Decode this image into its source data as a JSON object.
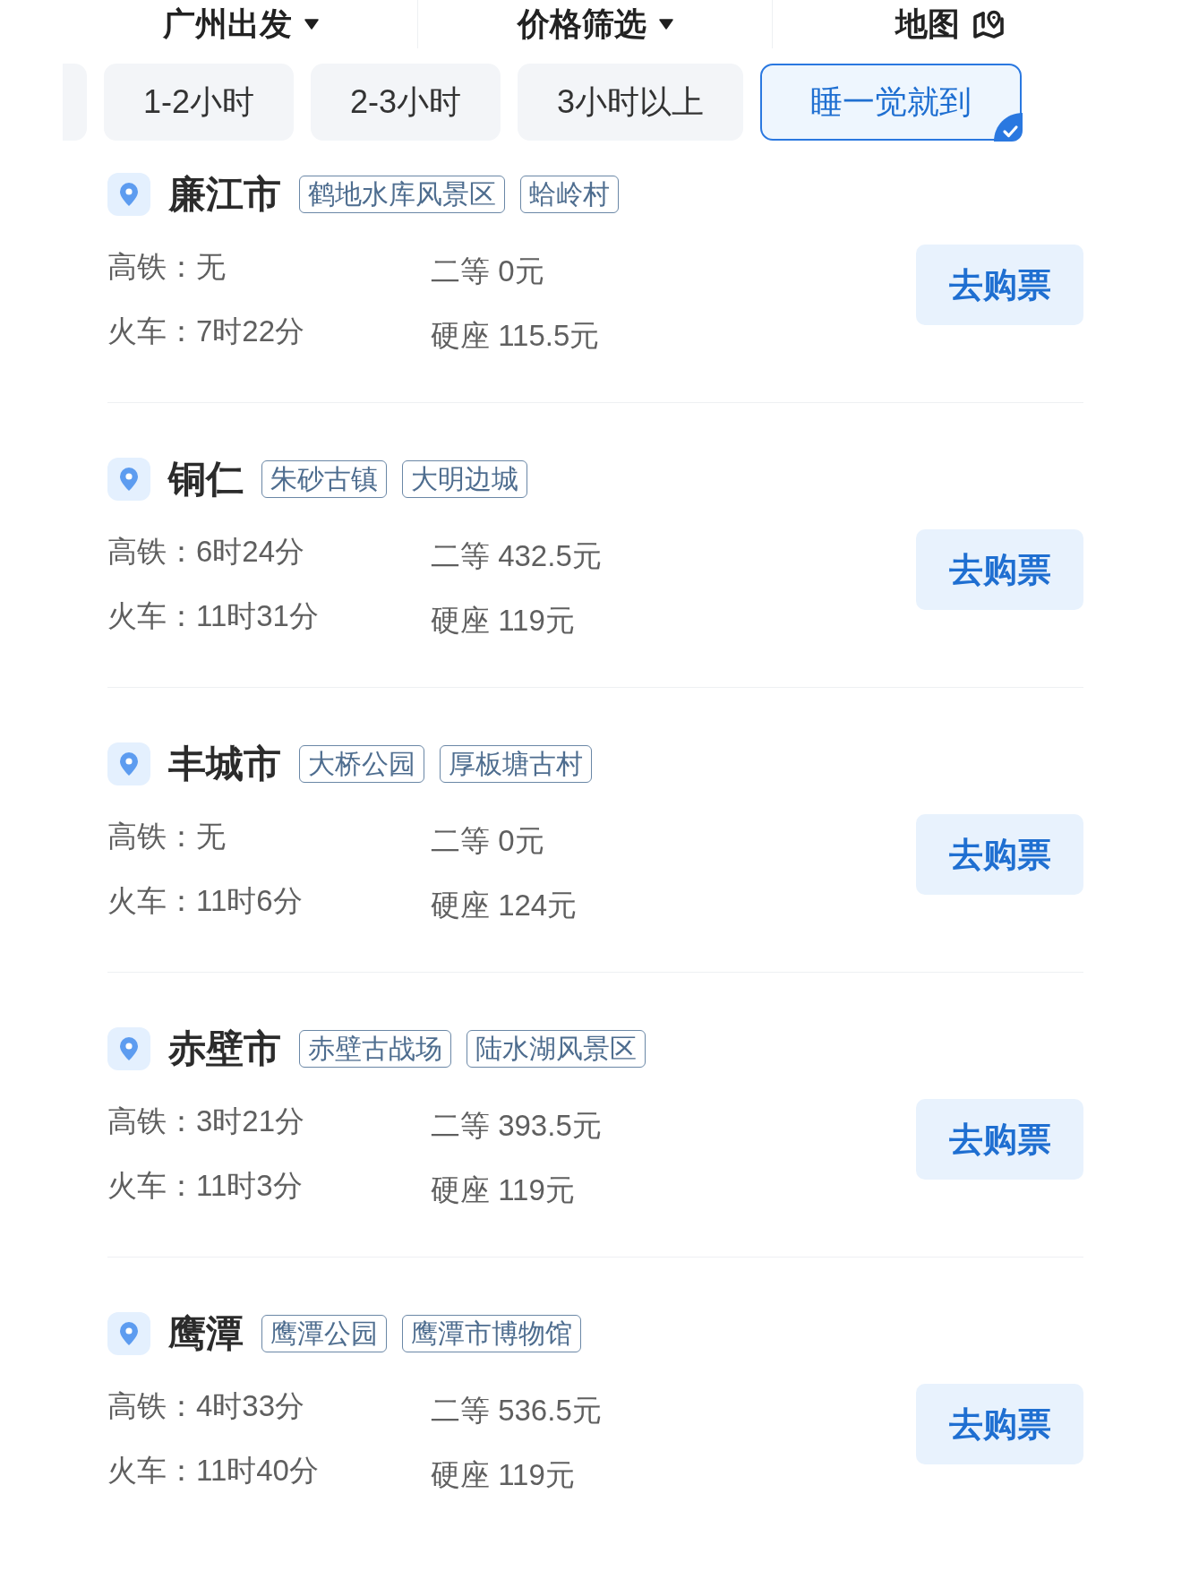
{
  "top_bar": {
    "items": [
      {
        "label": "广州出发",
        "kind": "dropdown"
      },
      {
        "label": "价格筛选",
        "kind": "dropdown"
      },
      {
        "label": "地图",
        "kind": "map"
      }
    ]
  },
  "duration_filters": [
    {
      "label": "1-2小时",
      "selected": false
    },
    {
      "label": "2-3小时",
      "selected": false
    },
    {
      "label": "3小时以上",
      "selected": false
    },
    {
      "label": "睡一觉就到",
      "selected": true
    }
  ],
  "destinations": [
    {
      "name": "廉江市",
      "tags": [
        "鹤地水库风景区",
        "蛤岭村"
      ],
      "high_speed": "高铁：无",
      "train": "火车：7时22分",
      "second_class": "二等 0元",
      "hard_seat": "硬座 115.5元",
      "button": "去购票"
    },
    {
      "name": "铜仁",
      "tags": [
        "朱砂古镇",
        "大明边城"
      ],
      "high_speed": "高铁：6时24分",
      "train": "火车：11时31分",
      "second_class": "二等 432.5元",
      "hard_seat": "硬座 119元",
      "button": "去购票"
    },
    {
      "name": "丰城市",
      "tags": [
        "大桥公园",
        "厚板塘古村"
      ],
      "high_speed": "高铁：无",
      "train": "火车：11时6分",
      "second_class": "二等 0元",
      "hard_seat": "硬座 124元",
      "button": "去购票"
    },
    {
      "name": "赤壁市",
      "tags": [
        "赤壁古战场",
        "陆水湖风景区"
      ],
      "high_speed": "高铁：3时21分",
      "train": "火车：11时3分",
      "second_class": "二等 393.5元",
      "hard_seat": "硬座 119元",
      "button": "去购票"
    },
    {
      "name": "鹰潭",
      "tags": [
        "鹰潭公园",
        "鹰潭市博物馆"
      ],
      "high_speed": "高铁：4时33分",
      "train": "火车：11时40分",
      "second_class": "二等 536.5元",
      "hard_seat": "硬座 119元",
      "button": "去购票"
    }
  ]
}
